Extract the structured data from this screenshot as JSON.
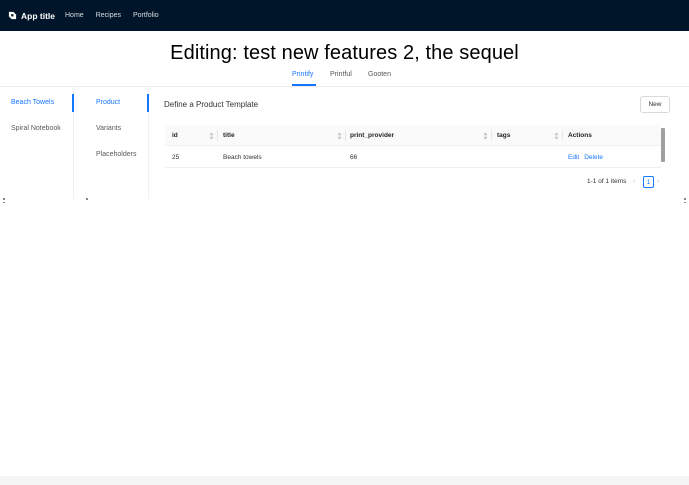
{
  "navbar": {
    "brand": "App title",
    "links": [
      "Home",
      "Recipes",
      "Portfolio"
    ]
  },
  "page": {
    "title": "Editing: test new features 2, the sequel"
  },
  "tabs": [
    {
      "label": "Printify",
      "active": true
    },
    {
      "label": "Printful",
      "active": false
    },
    {
      "label": "Gooten",
      "active": false
    }
  ],
  "products": [
    {
      "label": "Beach Towels",
      "active": true
    },
    {
      "label": "Spiral Notebook",
      "active": false
    }
  ],
  "sections": [
    {
      "label": "Product",
      "active": true
    },
    {
      "label": "Variants",
      "active": false
    },
    {
      "label": "Placeholders",
      "active": false
    }
  ],
  "content": {
    "title": "Define a Product Template",
    "new_button": "New"
  },
  "table": {
    "columns": [
      "id",
      "title",
      "print_provider",
      "tags",
      "Actions"
    ],
    "rows": [
      {
        "id": "25",
        "title": "Beach towels",
        "print_provider": "66",
        "tags": "",
        "actions": [
          "Edit",
          "Delete"
        ]
      }
    ]
  },
  "pagination": {
    "total_text": "1-1 of 1 items",
    "current_page": "1"
  },
  "colors": {
    "navbar": "#001529",
    "accent": "#1677ff"
  }
}
